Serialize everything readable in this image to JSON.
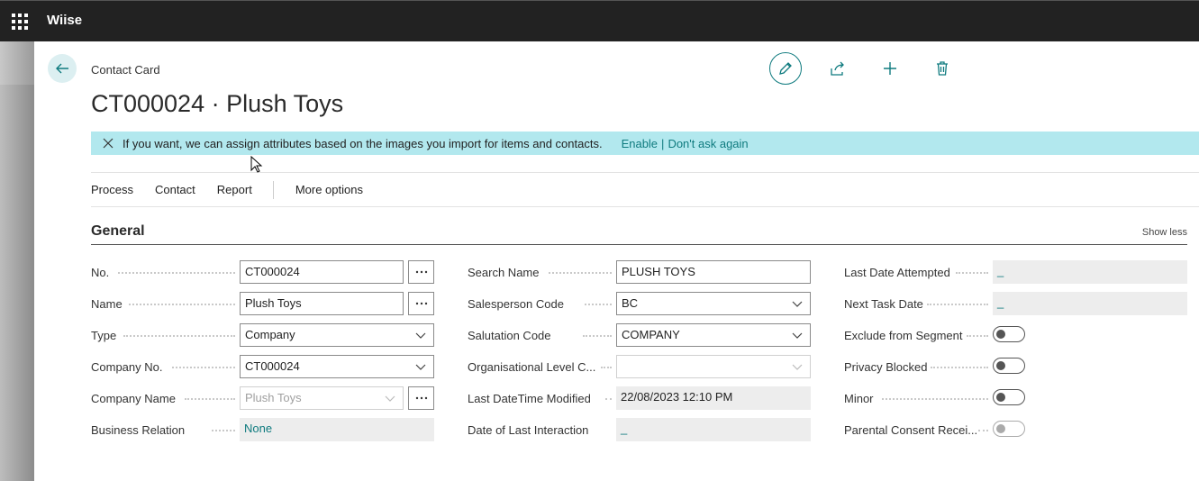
{
  "app": {
    "name": "Wiise"
  },
  "header": {
    "breadcrumb": "Contact Card",
    "title": "CT000024 · Plush Toys"
  },
  "banner": {
    "message": "If you want, we can assign attributes based on the images you import for items and contacts.",
    "enable_label": "Enable",
    "separator": "|",
    "dont_ask_label": "Don't ask again"
  },
  "menu": {
    "items": [
      "Process",
      "Contact",
      "Report"
    ],
    "more": "More options"
  },
  "section": {
    "title": "General",
    "toggle_label": "Show less"
  },
  "fields": {
    "no": {
      "label": "No.",
      "value": "CT000024"
    },
    "name": {
      "label": "Name",
      "value": "Plush Toys"
    },
    "type": {
      "label": "Type",
      "value": "Company"
    },
    "company_no": {
      "label": "Company No.",
      "value": "CT000024"
    },
    "company_name": {
      "label": "Company Name",
      "value": "Plush Toys"
    },
    "business_relation": {
      "label": "Business Relation",
      "value": "None"
    },
    "search_name": {
      "label": "Search Name",
      "value": "PLUSH TOYS"
    },
    "salesperson_code": {
      "label": "Salesperson Code",
      "value": "BC"
    },
    "salutation_code": {
      "label": "Salutation Code",
      "value": "COMPANY"
    },
    "org_level": {
      "label": "Organisational Level C...",
      "value": ""
    },
    "last_modified": {
      "label": "Last DateTime Modified",
      "value": "22/08/2023 12:10 PM"
    },
    "last_interaction": {
      "label": "Date of Last Interaction",
      "value": "_"
    },
    "last_attempted": {
      "label": "Last Date Attempted",
      "value": "_"
    },
    "next_task": {
      "label": "Next Task Date",
      "value": "_"
    },
    "exclude_segment": {
      "label": "Exclude from Segment",
      "value": false
    },
    "privacy_blocked": {
      "label": "Privacy Blocked",
      "value": false
    },
    "minor": {
      "label": "Minor",
      "value": false
    },
    "parental_consent": {
      "label": "Parental Consent Recei...",
      "value": false
    }
  },
  "colors": {
    "accent": "#0f7b7f",
    "banner": "#b2e8ee",
    "topbar": "#222222"
  }
}
